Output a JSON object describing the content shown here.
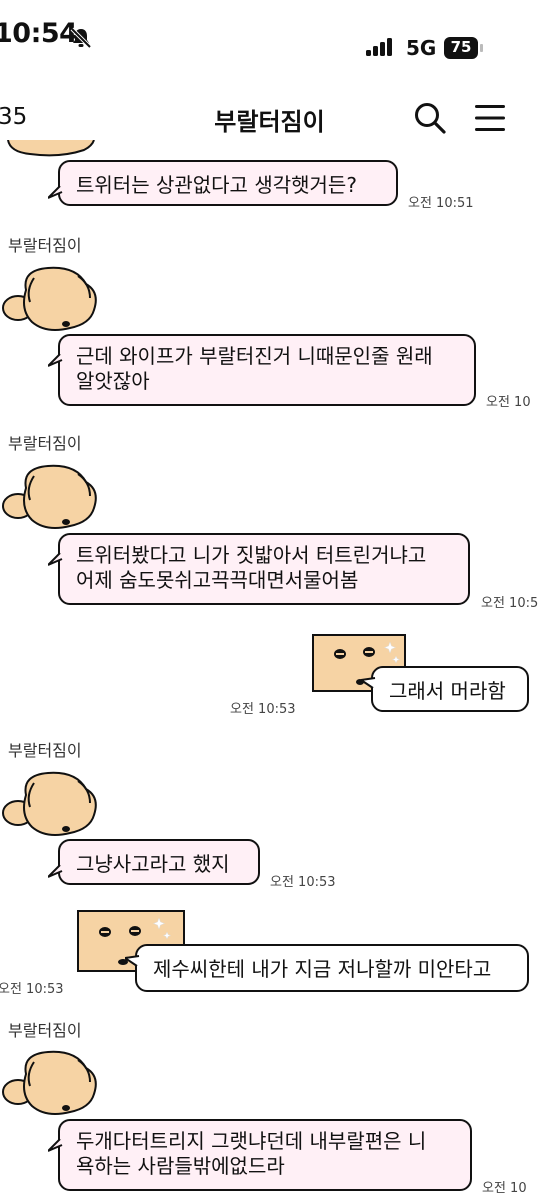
{
  "status_bar": {
    "time": "10:54",
    "network": "5G",
    "battery": "75"
  },
  "header": {
    "count": "35",
    "title": "부랄터짐이"
  },
  "messages": [
    {
      "text": "트위터는 상관없다고 생각햇거든?",
      "time": "오전 10:51"
    },
    {
      "sender": "부랄터짐이",
      "line1": "근데 와이프가 부랄터진거 니때문인줄 원래",
      "line2": "알앗잖아",
      "time": "오전 10"
    },
    {
      "sender": "부랄터짐이",
      "line1": "트위터봤다고 니가 짓밟아서 터트린거냐고",
      "line2": "어제 숨도못쉬고끅끅대면서물어봄",
      "time": "오전 10:5"
    },
    {
      "text": "그래서 머라함",
      "time": "오전 10:53"
    },
    {
      "sender": "부랄터짐이",
      "text": "그냥사고라고 했지",
      "time": "오전 10:53"
    },
    {
      "text": "제수씨한테 내가 지금 저나할까 미안타고",
      "time": "오전 10:53"
    },
    {
      "sender": "부랄터짐이",
      "line1": "두개다터트리지 그랫냐던데 내부랄편은 니",
      "line2": "욕하는 사람들밖에없드라",
      "time": "오전 10"
    }
  ],
  "icons": {
    "bell": "bell-slash-icon",
    "search": "search-icon",
    "menu": "hamburger-menu-icon",
    "avatar": "puppy-avatar"
  },
  "colors": {
    "incoming_bubble": "#fff0f6",
    "outgoing_bubble": "#ffffff",
    "sticker": "#f6d3a4"
  }
}
